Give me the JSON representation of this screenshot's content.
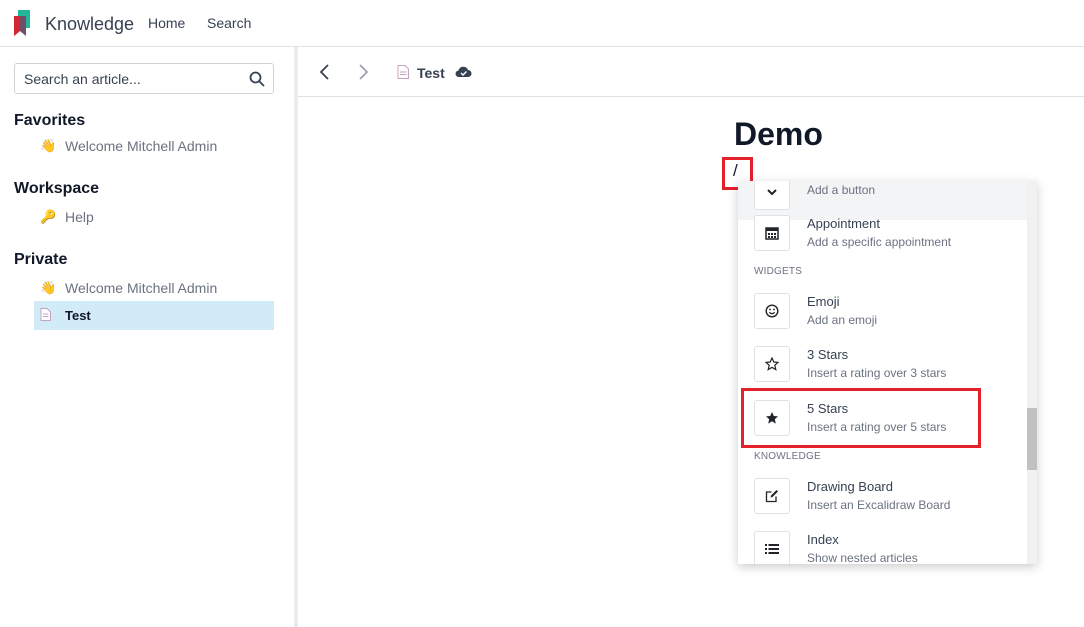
{
  "topbar": {
    "app_name": "Knowledge",
    "nav": {
      "home": "Home",
      "search": "Search"
    },
    "brand_colors": [
      "#21b799",
      "#714b67",
      "#e4202a"
    ]
  },
  "sidebar": {
    "search": {
      "placeholder": "Search an article..."
    },
    "sections": {
      "favorites": {
        "title": "Favorites",
        "items": [
          {
            "emoji": "👋",
            "label": "Welcome Mitchell Admin"
          }
        ]
      },
      "workspace": {
        "title": "Workspace",
        "items": [
          {
            "emoji": "🔑",
            "label": "Help"
          }
        ]
      },
      "private": {
        "title": "Private",
        "items": [
          {
            "emoji": "👋",
            "label": "Welcome Mitchell Admin"
          },
          {
            "emoji": "doc-icon",
            "label": "Test",
            "active": true
          }
        ]
      }
    }
  },
  "toolbar": {
    "breadcrumb_title": "Test",
    "icons": [
      "chevron-left-icon",
      "chevron-right-icon",
      "document-icon",
      "cloud-check-icon"
    ]
  },
  "editor": {
    "title": "Demo",
    "typed_text": "/"
  },
  "command_palette": {
    "items": [
      {
        "icon": "chevron-down-icon",
        "title": "",
        "desc": "Add a button"
      },
      {
        "icon": "calendar-icon",
        "title": "Appointment",
        "desc": "Add a specific appointment"
      },
      {
        "category": "WIDGETS"
      },
      {
        "icon": "smile-icon",
        "title": "Emoji",
        "desc": "Add an emoji"
      },
      {
        "icon": "star-outline-icon",
        "title": "3 Stars",
        "desc": "Insert a rating over 3 stars"
      },
      {
        "icon": "star-filled-icon",
        "title": "5 Stars",
        "desc": "Insert a rating over 5 stars",
        "highlighted": true
      },
      {
        "category": "KNOWLEDGE"
      },
      {
        "icon": "edit-icon",
        "title": "Drawing Board",
        "desc": "Insert an Excalidraw Board"
      },
      {
        "icon": "list-icon",
        "title": "Index",
        "desc": "Show nested articles"
      }
    ]
  }
}
